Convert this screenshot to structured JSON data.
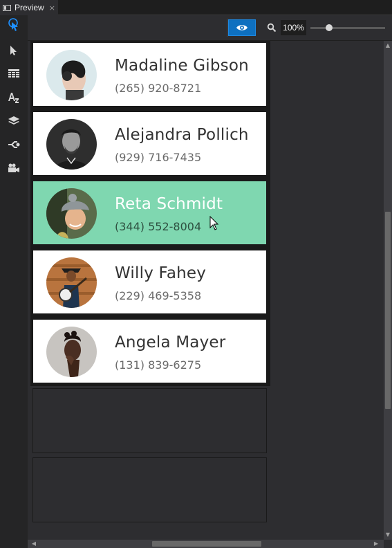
{
  "tab": {
    "label": "Preview",
    "close_glyph": "×",
    "icon": "preview-icon"
  },
  "sidebar": {
    "tools": [
      {
        "name": "touch-tool-icon",
        "active": true
      },
      {
        "name": "pointer-icon"
      },
      {
        "name": "grid-icon"
      },
      {
        "name": "text-style-icon"
      },
      {
        "name": "layers-icon"
      },
      {
        "name": "connector-icon"
      },
      {
        "name": "video-camera-icon"
      }
    ]
  },
  "toolbar": {
    "preview_button_icon": "eye-icon",
    "search_icon": "magnifier-icon",
    "zoom": "100%",
    "zoom_level": 0.25
  },
  "contacts": [
    {
      "name": "Madaline Gibson",
      "phone": "(265) 920-8721",
      "selected": false
    },
    {
      "name": "Alejandra Pollich",
      "phone": "(929) 716-7435",
      "selected": false
    },
    {
      "name": "Reta Schmidt",
      "phone": "(344) 552-8004",
      "selected": true
    },
    {
      "name": "Willy Fahey",
      "phone": "(229) 469-5358",
      "selected": false
    },
    {
      "name": "Angela Mayer",
      "phone": "(131) 839-6275",
      "selected": false
    }
  ],
  "colors": {
    "accent": "#0e70c0",
    "selected_row": "#7fd7b0",
    "card_bg": "#ffffff",
    "canvas_bg": "#2d2d30"
  }
}
